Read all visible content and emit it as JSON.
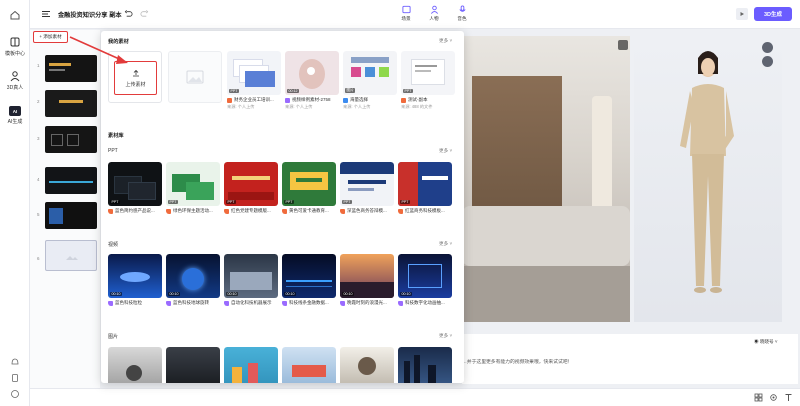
{
  "app": {
    "doc_title": "金融投资知识分享 副本",
    "nav": [
      {
        "label": "模板中心"
      },
      {
        "label": "3D真人"
      },
      {
        "label": "AI生成",
        "icon_text": "AI"
      }
    ],
    "top_tools": [
      {
        "label": "场景"
      },
      {
        "label": "人物"
      },
      {
        "label": "音色"
      }
    ],
    "generate_label": "3D生成",
    "accent": "#6b5cff",
    "highlight": "#e23b3b"
  },
  "scenes": {
    "add_label": "+ 添加素材",
    "numbers": [
      "1",
      "2",
      "3",
      "4",
      "5",
      "6"
    ]
  },
  "popup": {
    "my_materials_title": "我的素材",
    "more_label": "更多 ˅",
    "upload_label": "上传素材",
    "my_items": [
      {
        "caption": "财务企业员工培训...",
        "sub": "来源: 个人上传",
        "badge": "PPT"
      },
      {
        "caption": "视频样例素材-2758",
        "sub": "来源: 个人上传",
        "badge": "00:12"
      },
      {
        "caption": "海量选择",
        "sub": "来源: 个人上传",
        "badge": "图片"
      },
      {
        "caption": "测试-副本",
        "sub": "来源: 488 的文件",
        "badge": "PPT"
      }
    ],
    "library_title": "素材库",
    "ppt_title": "PPT",
    "ppt_items": [
      {
        "caption": "蓝色简约感产品说...",
        "badge": "PPT"
      },
      {
        "caption": "绿色环保主题活动...",
        "badge": "PPT"
      },
      {
        "caption": "红色党建专题模版...",
        "badge": "PPT"
      },
      {
        "caption": "黄色可爱卡通教育...",
        "badge": "PPT"
      },
      {
        "caption": "深蓝色商务答辩模...",
        "badge": "PPT"
      },
      {
        "caption": "红蓝商务科技模板...",
        "badge": "PPT"
      }
    ],
    "video_title": "视频",
    "video_items": [
      {
        "caption": "蓝色科技粒粒",
        "badge": "00:10"
      },
      {
        "caption": "蓝色科技地球旋转",
        "badge": "00:10"
      },
      {
        "caption": "自动化科技机器展示",
        "badge": "00:10"
      },
      {
        "caption": "科技线条金融数据...",
        "badge": "00:10"
      },
      {
        "caption": "晚霞时刻的浪漫光...",
        "badge": "00:10"
      },
      {
        "caption": "科技数字化动画抽...",
        "badge": "00:10"
      }
    ],
    "image_title": "图片"
  },
  "script": {
    "text": "…并于这里更多有能力的视频效果哦，快来试试吧！",
    "voice": "◉ 晓晓号 ˅"
  }
}
